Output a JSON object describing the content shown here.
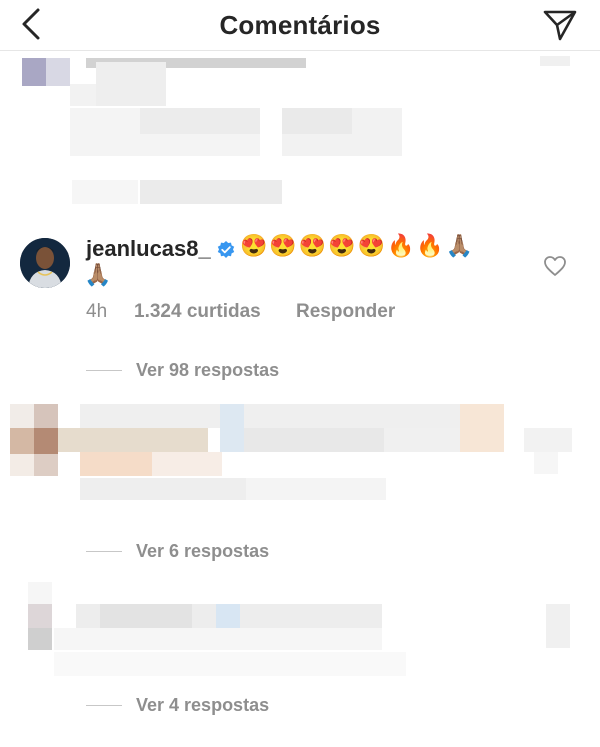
{
  "header": {
    "title": "Comentários",
    "back_icon": "chevron-left-icon",
    "send_icon": "paper-plane-icon"
  },
  "comment": {
    "username": "jeanlucas8_",
    "verified_icon": "verified-badge-icon",
    "text_line1": "😍😍😍😍😍🔥🔥🙏🏽",
    "text_line2": "🙏🏽",
    "time": "4h",
    "likes": "1.324 curtidas",
    "reply_label": "Responder",
    "like_icon": "heart-outline-icon",
    "view_replies": "Ver 98 respostas"
  },
  "other_threads": [
    {
      "view_replies": "Ver 6 respostas"
    },
    {
      "view_replies": "Ver 4 respostas"
    }
  ],
  "colors": {
    "text": "#262626",
    "secondary": "#8e8e8e",
    "verified": "#3897f0",
    "divider": "#e6e6e6"
  }
}
